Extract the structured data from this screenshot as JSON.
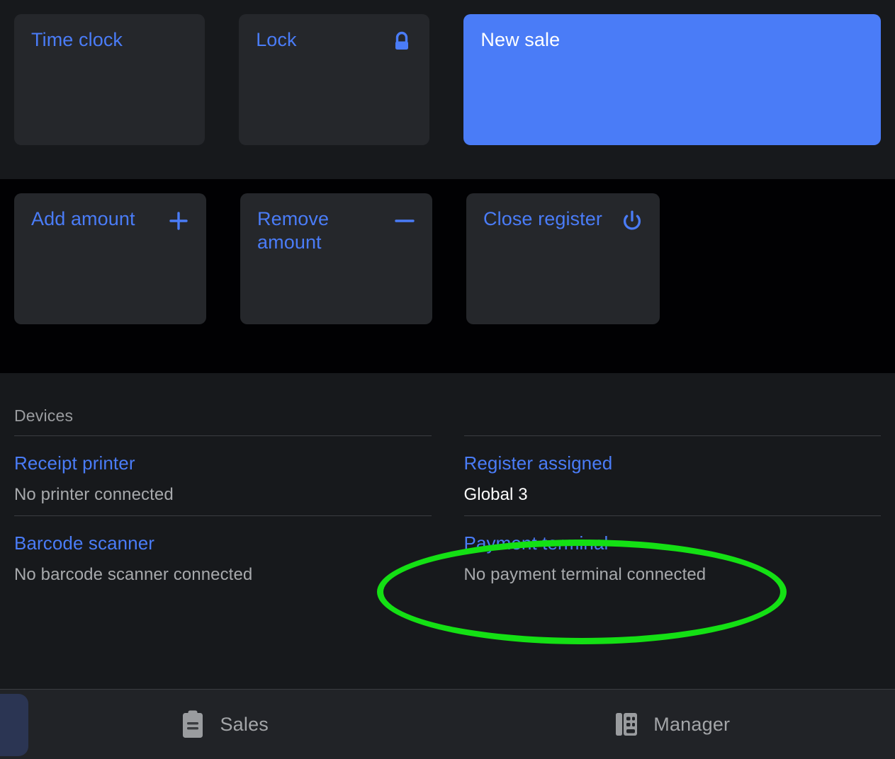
{
  "top_actions": [
    {
      "label": "Time clock",
      "icon": "none",
      "variant": "secondary",
      "width": "small"
    },
    {
      "label": "Lock",
      "icon": "lock-icon",
      "variant": "secondary",
      "width": "small"
    },
    {
      "label": "New sale",
      "icon": "none",
      "variant": "primary",
      "width": "wide"
    }
  ],
  "cash_actions": [
    {
      "label": "Add amount",
      "icon": "plus-icon",
      "width": "small"
    },
    {
      "label": "Remove amount",
      "icon": "minus-icon",
      "width": "small"
    },
    {
      "label": "Close register",
      "icon": "power-icon",
      "width": "mid"
    }
  ],
  "devices": {
    "title": "Devices",
    "left_column": [
      {
        "name": "Receipt printer",
        "status": "No printer connected",
        "status_strong": false
      },
      {
        "name": "Barcode scanner",
        "status": "No barcode scanner connected",
        "status_strong": false
      }
    ],
    "right_column": [
      {
        "name": "Register assigned",
        "status": "Global 3",
        "status_strong": true
      },
      {
        "name": "Payment terminal",
        "status": "No payment terminal connected",
        "status_strong": false
      }
    ]
  },
  "bottom_nav": [
    {
      "label": "Sales",
      "icon": "clipboard-icon"
    },
    {
      "label": "Manager",
      "icon": "building-icon"
    }
  ],
  "colors": {
    "accent_blue": "#4a7cf7",
    "tile_bg": "#25272b",
    "panel_bg": "#17191c",
    "cash_bg": "#010103",
    "nav_bg": "#212327",
    "nav_highlight": "#2b3553",
    "muted_text": "#a7a9ac",
    "annotation_green": "#14e014"
  },
  "annotation": {
    "shape": "ellipse",
    "color": "#14e014",
    "targets": "Payment terminal"
  }
}
